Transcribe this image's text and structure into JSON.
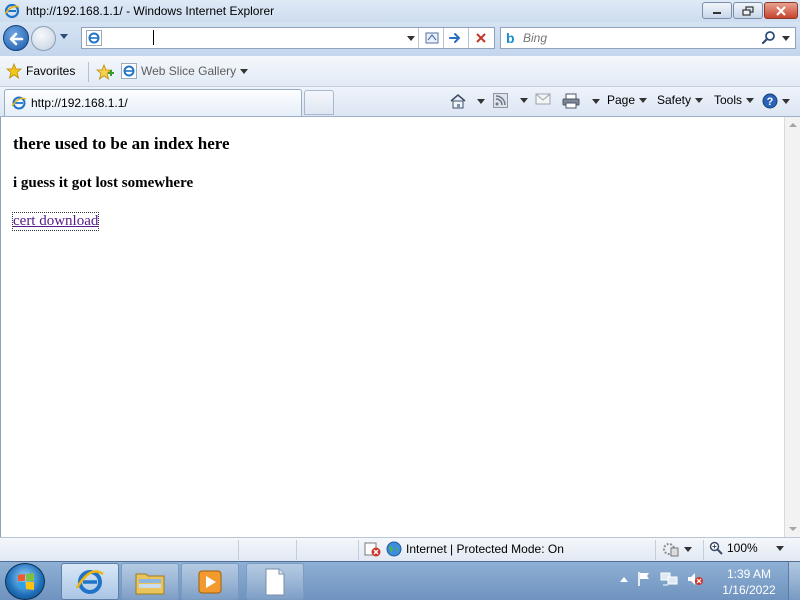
{
  "window": {
    "title": "http://192.168.1.1/ - Windows Internet Explorer"
  },
  "address_bar": {
    "value": "",
    "placeholder": ""
  },
  "search_box": {
    "placeholder": "Bing"
  },
  "favorites_bar": {
    "favorites_label": "Favorites",
    "web_slice_label": "Web Slice Gallery"
  },
  "tab": {
    "label": "http://192.168.1.1/"
  },
  "command_bar": {
    "page_label": "Page",
    "safety_label": "Safety",
    "tools_label": "Tools"
  },
  "page": {
    "heading": "there used to be an index here",
    "subheading": "i guess it got lost somewhere",
    "link_text": "cert download"
  },
  "status_bar": {
    "zone_text": "Internet | Protected Mode: On",
    "zoom_text": "100%"
  },
  "taskbar": {
    "time": "1:39 AM",
    "date": "1/16/2022"
  },
  "colors": {
    "visited_link": "#551a8b",
    "close_button": "#c6452d"
  }
}
